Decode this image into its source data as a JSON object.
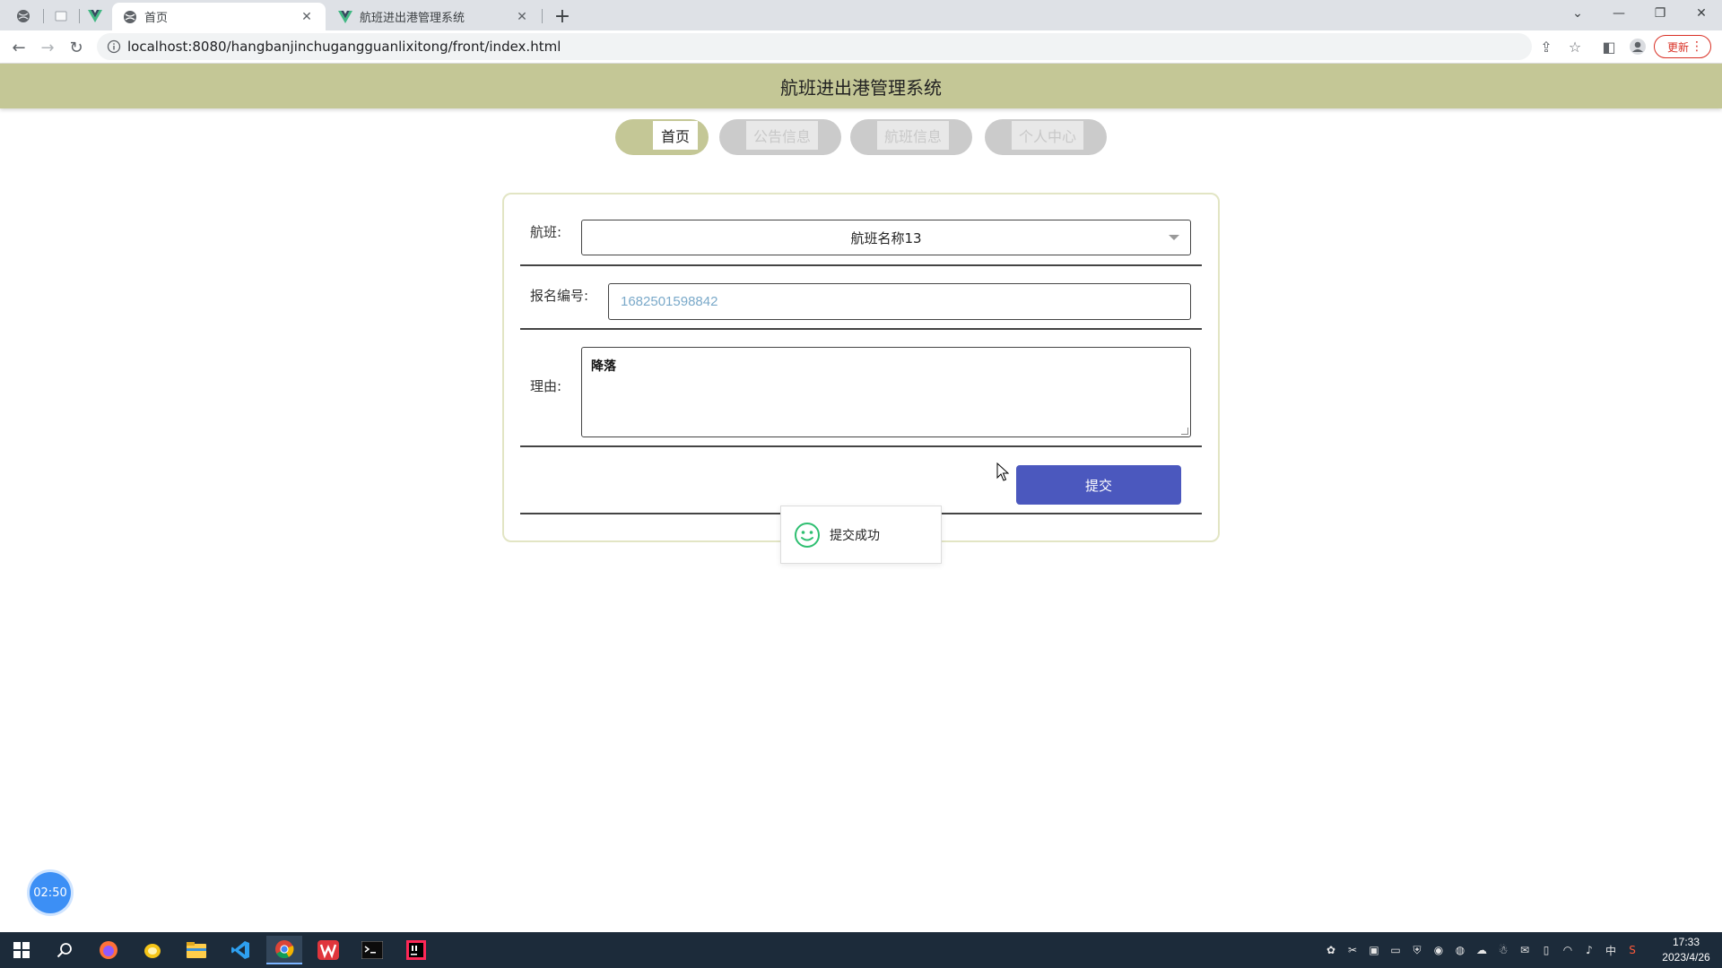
{
  "browser": {
    "tabs": [
      {
        "title": "首页",
        "active": true
      },
      {
        "title": "航班进出港管理系统",
        "active": false
      }
    ],
    "url": "localhost:8080/hangbanjinchugangguanlixitong/front/index.html",
    "update_label": "更新"
  },
  "site": {
    "title": "航班进出港管理系统",
    "nav": [
      {
        "label": "首页",
        "active": true
      },
      {
        "label": "公告信息",
        "active": false
      },
      {
        "label": "航班信息",
        "active": false
      },
      {
        "label": "个人中心",
        "active": false
      }
    ]
  },
  "form": {
    "flight_label": "航班:",
    "flight_value": "航班名称13",
    "reg_label": "报名编号:",
    "reg_value": "1682501598842",
    "reason_label": "理由:",
    "reason_value": "降落",
    "submit_label": "提交"
  },
  "toast": {
    "message": "提交成功"
  },
  "timer": {
    "value": "02:50"
  },
  "taskbar": {
    "time": "17:33",
    "date": "2023/4/26",
    "ime": "中"
  },
  "colors": {
    "header_bg": "#c4c796",
    "button_bg": "#4b58be",
    "taskbar_bg": "#1c2b3a"
  }
}
